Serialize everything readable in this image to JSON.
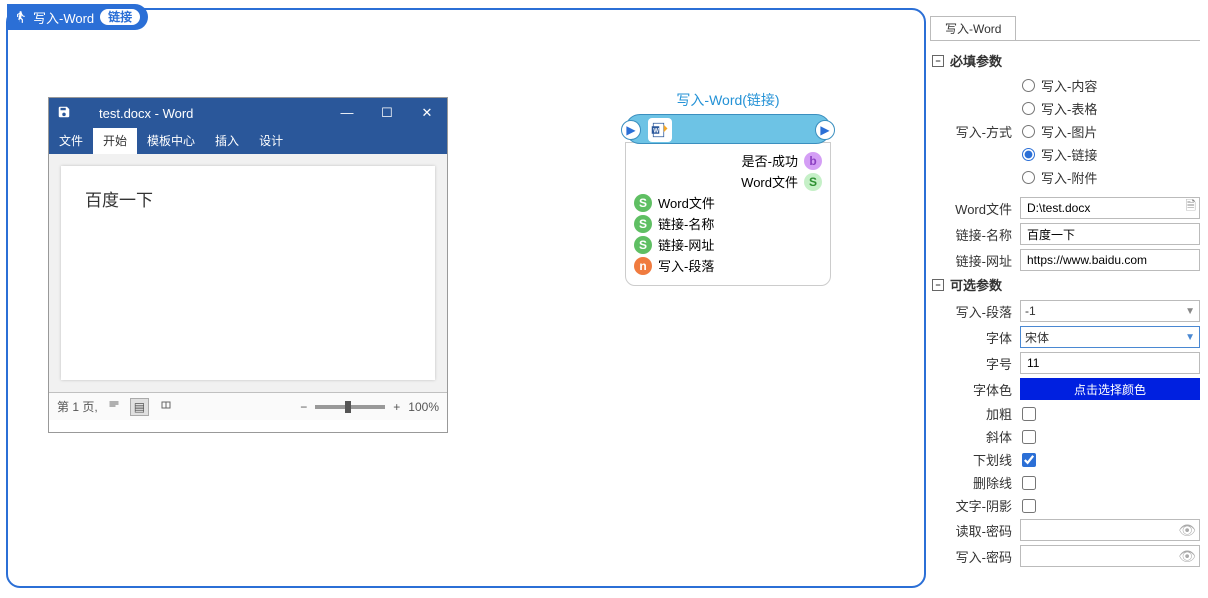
{
  "header": {
    "title": "写入-Word",
    "badge": "链接"
  },
  "word": {
    "titlebar": "test.docx  -  Word",
    "tabs": {
      "file": "文件",
      "home": "开始",
      "template": "模板中心",
      "insert": "插入",
      "design": "设计"
    },
    "content": "百度一下",
    "status_page": "第 1 页,",
    "status_lang": "",
    "zoom": "100%"
  },
  "node": {
    "title": "写入-Word(链接)",
    "out_success": "是否-成功",
    "out_file": "Word文件",
    "in_file": "Word文件",
    "in_name": "链接-名称",
    "in_url": "链接-网址",
    "in_para": "写入-段落"
  },
  "panel": {
    "tab": "写入-Word",
    "section_required": "必填参数",
    "section_optional": "可选参数",
    "write_mode_label": "写入-方式",
    "modes": {
      "content": "写入-内容",
      "table": "写入-表格",
      "image": "写入-图片",
      "link": "写入-链接",
      "attach": "写入-附件"
    },
    "word_file_label": "Word文件",
    "word_file_value": "D:\\test.docx",
    "link_name_label": "链接-名称",
    "link_name_value": "百度一下",
    "link_url_label": "链接-网址",
    "link_url_value": "https://www.baidu.com",
    "para_label": "写入-段落",
    "para_value": "-1",
    "font_label": "字体",
    "font_value": "宋体",
    "size_label": "字号",
    "size_value": "11",
    "color_label": "字体色",
    "color_btn": "点击选择颜色",
    "bold_label": "加粗",
    "italic_label": "斜体",
    "underline_label": "下划线",
    "strike_label": "删除线",
    "shadow_label": "文字-阴影",
    "read_pwd_label": "读取-密码",
    "write_pwd_label": "写入-密码"
  }
}
